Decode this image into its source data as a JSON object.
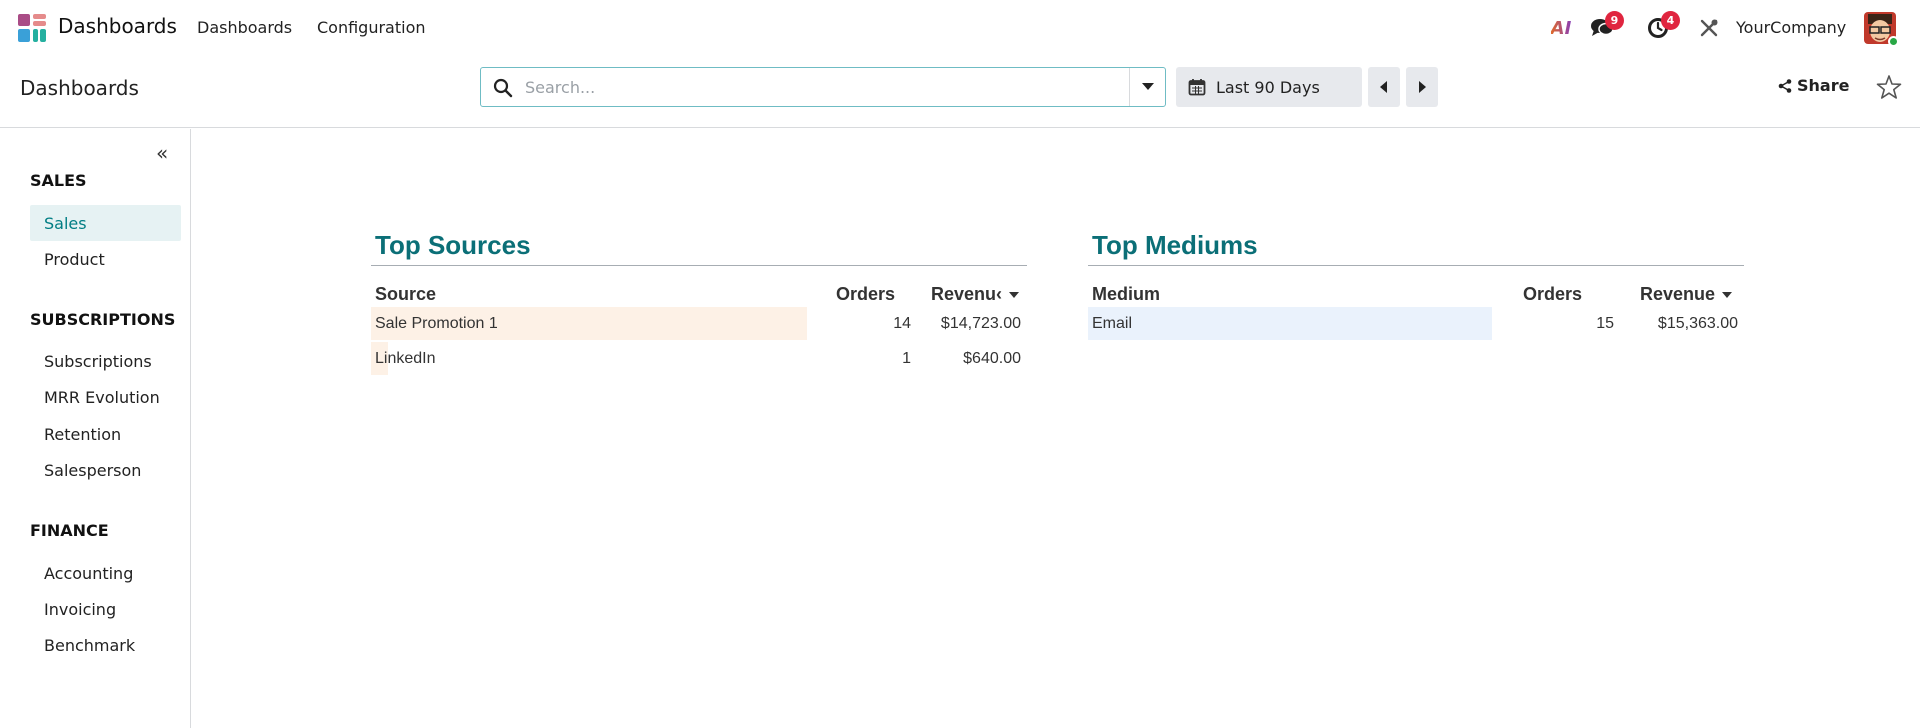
{
  "navbar": {
    "brand": "Dashboards",
    "menu": [
      {
        "label": "Dashboards"
      },
      {
        "label": "Configuration"
      }
    ],
    "ai_label": "AI",
    "messages_count": "9",
    "activities_count": "4",
    "company": "YourCompany",
    "badge_color": "#e0253f"
  },
  "control_panel": {
    "title": "Dashboards",
    "search_placeholder": "Search...",
    "period_label": "Last 90 Days",
    "share_label": "Share"
  },
  "sidebar": {
    "sections": [
      {
        "title": "SALES",
        "items": [
          {
            "label": "Sales",
            "active": true
          },
          {
            "label": "Product"
          }
        ]
      },
      {
        "title": "SUBSCRIPTIONS",
        "items": [
          {
            "label": "Subscriptions"
          },
          {
            "label": "MRR Evolution"
          },
          {
            "label": "Retention"
          },
          {
            "label": "Salesperson"
          }
        ]
      },
      {
        "title": "FINANCE",
        "items": [
          {
            "label": "Accounting"
          },
          {
            "label": "Invoicing"
          },
          {
            "label": "Benchmark"
          }
        ]
      }
    ]
  },
  "top_sources": {
    "title": "Top Sources",
    "col_source": "Source",
    "col_orders": "Orders",
    "col_revenue": "Revenu‹",
    "rows": [
      {
        "name": "Sale Promotion 1",
        "orders": "14",
        "revenue": "$14,723.00",
        "share": 1.0
      },
      {
        "name": "LinkedIn",
        "orders": "1",
        "revenue": "$640.00",
        "share": 0.04
      }
    ],
    "bar_color": "#fdf1e6"
  },
  "top_mediums": {
    "title": "Top Mediums",
    "col_medium": "Medium",
    "col_orders": "Orders",
    "col_revenue": "Revenue",
    "rows": [
      {
        "name": "Email",
        "orders": "15",
        "revenue": "$15,363.00",
        "share": 1.0
      }
    ],
    "bar_color": "#eaf2fc"
  },
  "colors": {
    "accent": "#017e84",
    "title": "#0b6f77"
  }
}
